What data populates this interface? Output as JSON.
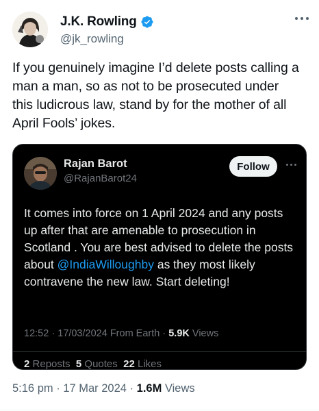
{
  "author": {
    "name": "J.K. Rowling",
    "handle": "@jk_rowling"
  },
  "tweet": {
    "lines": [
      "If you genuinely imagine I’d delete posts calling a",
      "man a man, so as not to be prosecuted under",
      "this ludicrous law, stand by for the mother of all",
      "April Fools’ jokes."
    ],
    "time": "5:16 pm",
    "date": "17 Mar 2024",
    "views_count": "1.6M",
    "views_label": "Views"
  },
  "quoted": {
    "name": "Rajan Barot",
    "handle": "@RajanBarot24",
    "follow_label": "Follow",
    "text_before": "It comes into force on 1 April 2024 and any posts up after that are amenable to prosecution in Scotland . You are best advised to delete the posts about ",
    "mention": "@IndiaWilloughby",
    "text_after": " as they most likely contravene the new law. Start deleting!",
    "time": "12:52",
    "date": "17/03/2024",
    "source": "From Earth",
    "views_count": "5.9K",
    "views_label": "Views",
    "reposts_count": "2",
    "reposts_label": "Reposts",
    "quotes_count": "5",
    "quotes_label": "Quotes",
    "likes_count": "22",
    "likes_label": "Likes"
  },
  "separator": "·",
  "colors": {
    "verified": "#1d9bf0",
    "mention": "#1d9bf0",
    "quote_bg": "#000000",
    "follow_bg": "#eff3f4"
  }
}
